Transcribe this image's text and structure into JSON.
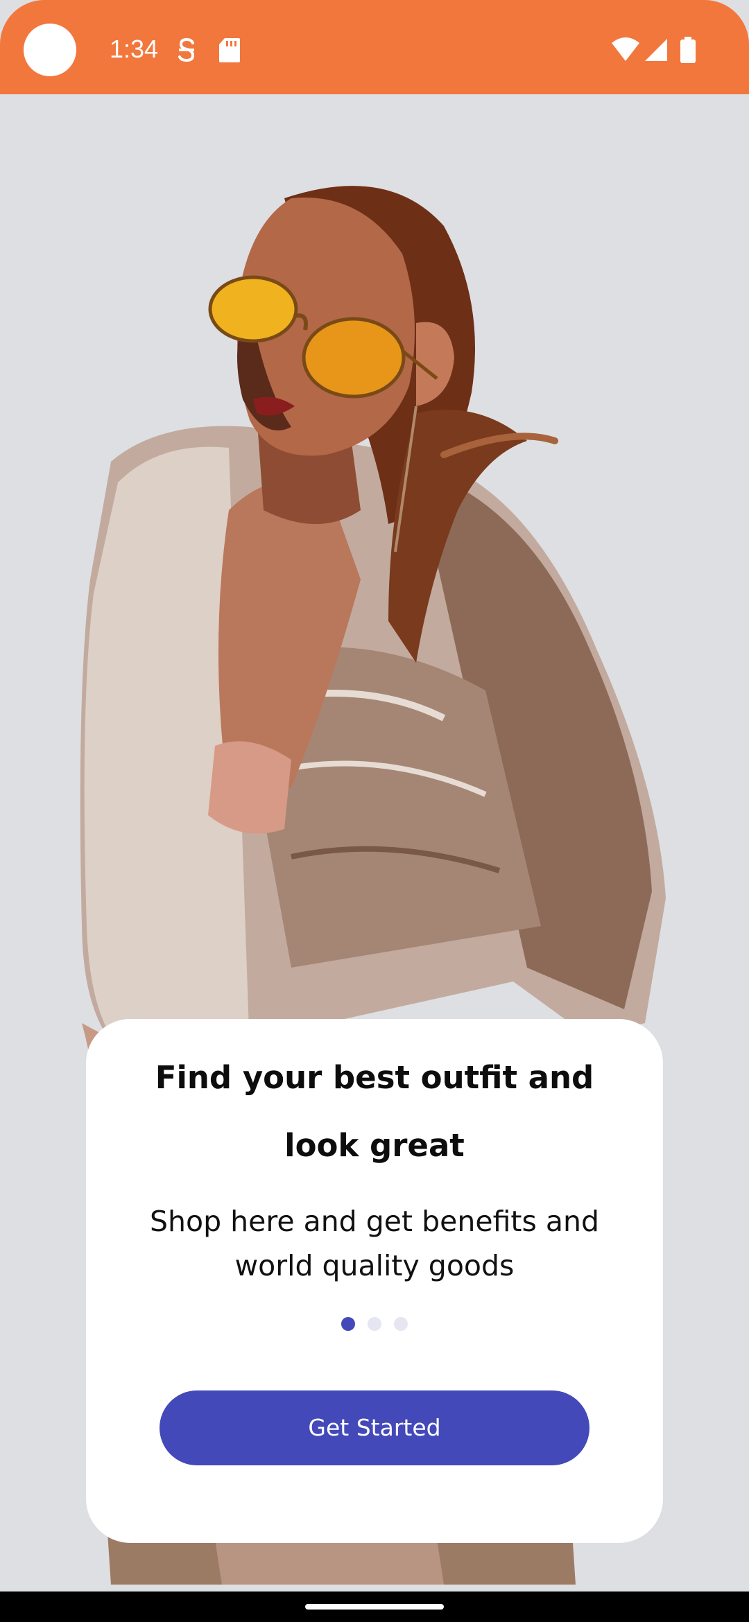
{
  "status_bar": {
    "time": "1:34",
    "background_color": "#f2773d",
    "icons": [
      "camera-dot",
      "s-notification-icon",
      "sd-card-icon",
      "wifi-icon",
      "cell-signal-icon",
      "battery-icon"
    ]
  },
  "onboarding": {
    "title": "Find your best outfit and look great",
    "subtitle": "Shop here and get benefits and world quality goods",
    "page_indicator": {
      "total": 3,
      "active": 1,
      "active_color": "#4349b8",
      "inactive_color": "#e6e6f3"
    },
    "cta_label": "Get Started",
    "cta_color": "#4349b8"
  }
}
